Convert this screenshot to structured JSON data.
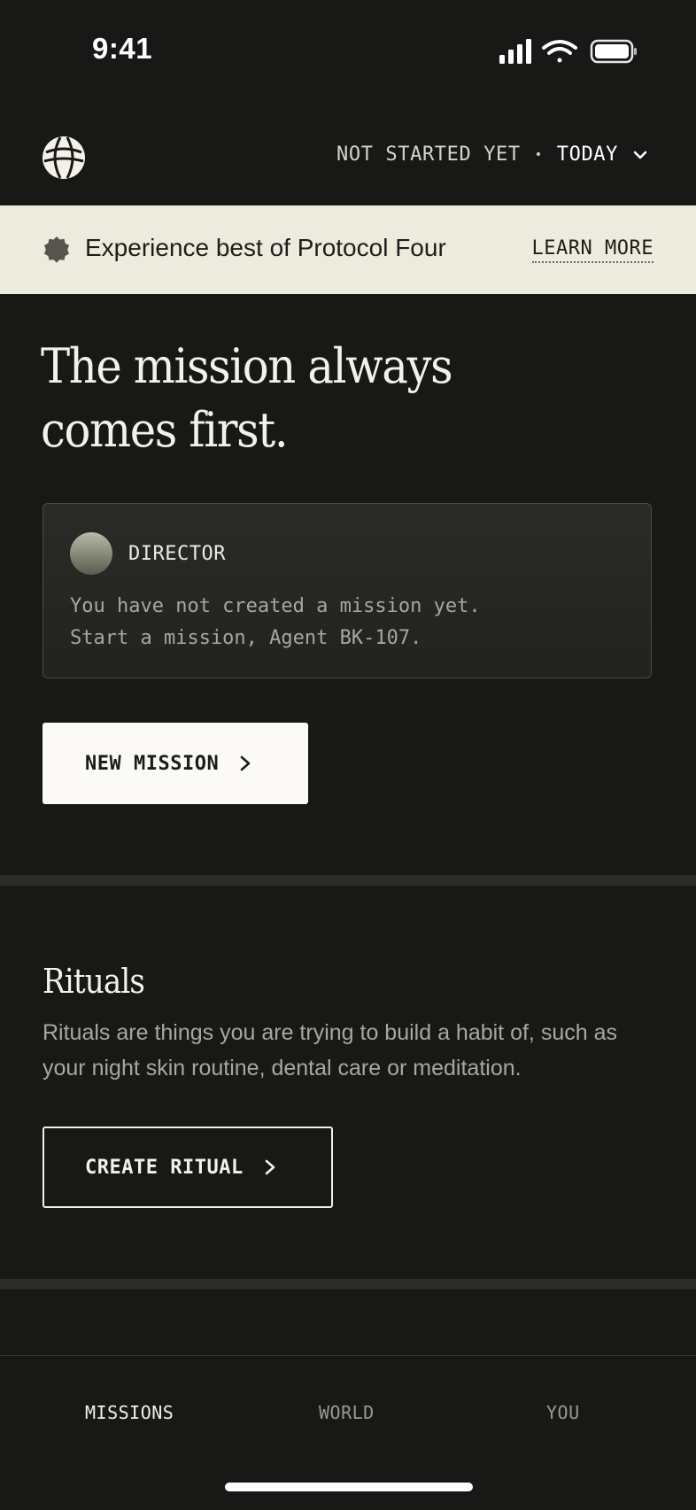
{
  "status_bar": {
    "time": "9:41"
  },
  "header": {
    "logo_icon": "globe-icon",
    "filter": {
      "status": "NOT STARTED YET",
      "separator": "•",
      "period": "TODAY"
    }
  },
  "banner": {
    "icon": "badge-icon",
    "text": "Experience best of Protocol Four",
    "link": "LEARN MORE"
  },
  "hero": {
    "title_line1": "The mission always",
    "title_line2": "comes first."
  },
  "director_card": {
    "label": "DIRECTOR",
    "message_line1": "You have not created a mission yet.",
    "message_line2": "Start a mission, Agent BK-107."
  },
  "new_mission_button": {
    "label": "NEW MISSION"
  },
  "rituals": {
    "title": "Rituals",
    "description": "Rituals are things you are trying to build a habit of, such as your night skin routine, dental care or meditation.",
    "button_label": "CREATE RITUAL"
  },
  "tabbar": {
    "tabs": [
      {
        "label": "MISSIONS",
        "active": true
      },
      {
        "label": "WORLD",
        "active": false
      },
      {
        "label": "YOU",
        "active": false
      }
    ]
  },
  "colors": {
    "background": "#181916",
    "banner": "#ecebde",
    "primary_button": "#fbfaf6",
    "muted_text": "#a9a79d"
  }
}
